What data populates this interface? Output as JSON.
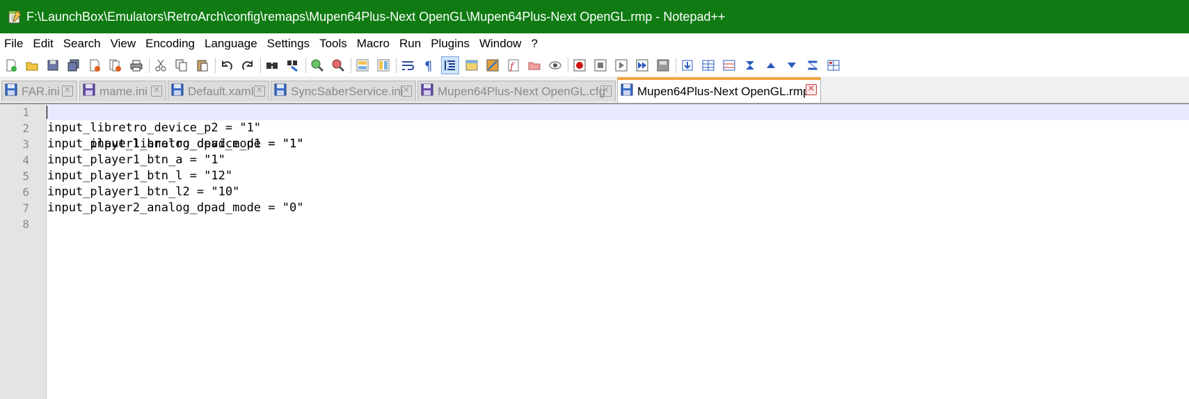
{
  "window": {
    "title": "F:\\LaunchBox\\Emulators\\RetroArch\\config\\remaps\\Mupen64Plus-Next OpenGL\\Mupen64Plus-Next OpenGL.rmp - Notepad++",
    "titlebar_color": "#0f7b12"
  },
  "menu": [
    "File",
    "Edit",
    "Search",
    "View",
    "Encoding",
    "Language",
    "Settings",
    "Tools",
    "Macro",
    "Run",
    "Plugins",
    "Window",
    "?"
  ],
  "toolbar": {
    "icons": [
      "new-file-icon",
      "open-file-icon",
      "save-icon",
      "save-all-icon",
      "close-icon",
      "close-all-icon",
      "print-icon",
      "cut-icon",
      "copy-icon",
      "paste-icon",
      "undo-icon",
      "redo-icon",
      "find-icon",
      "replace-icon",
      "zoom-in-icon",
      "zoom-out-icon",
      "sync-vertical-icon",
      "sync-horizontal-icon",
      "word-wrap-icon",
      "show-all-chars-icon",
      "indent-guide-icon",
      "udl-icon",
      "doc-map-icon",
      "function-list-icon",
      "folder-workspace-icon",
      "monitoring-icon",
      "record-macro-icon",
      "stop-macro-icon",
      "play-macro-icon",
      "run-macro-multiple-icon",
      "save-macro-icon",
      "plugin-a-icon",
      "plugin-b-icon",
      "plugin-c-icon",
      "plugin-d-icon",
      "plugin-e-icon",
      "plugin-f-icon",
      "plugin-g-icon",
      "plugin-h-icon"
    ]
  },
  "tabs": [
    {
      "label": "FAR.ini",
      "active": false
    },
    {
      "label": "mame.ini",
      "active": false
    },
    {
      "label": "Default.xaml",
      "active": false
    },
    {
      "label": "SyncSaberService.ini",
      "active": false
    },
    {
      "label": "Mupen64Plus-Next OpenGL.cfg",
      "active": false
    },
    {
      "label": "Mupen64Plus-Next OpenGL.rmp",
      "active": true
    }
  ],
  "editor": {
    "line_numbers": [
      "1",
      "2",
      "3",
      "4",
      "5",
      "6",
      "7",
      "8"
    ],
    "lines": [
      "input_libretro_device_p1 = \"1\"",
      "input_libretro_device_p2 = \"1\"",
      "input_player1_analog_dpad_mode = \"1\"",
      "input_player1_btn_a = \"1\"",
      "input_player1_btn_l = \"12\"",
      "input_player1_btn_l2 = \"10\"",
      "input_player2_analog_dpad_mode = \"0\"",
      ""
    ],
    "current_line": 1
  }
}
